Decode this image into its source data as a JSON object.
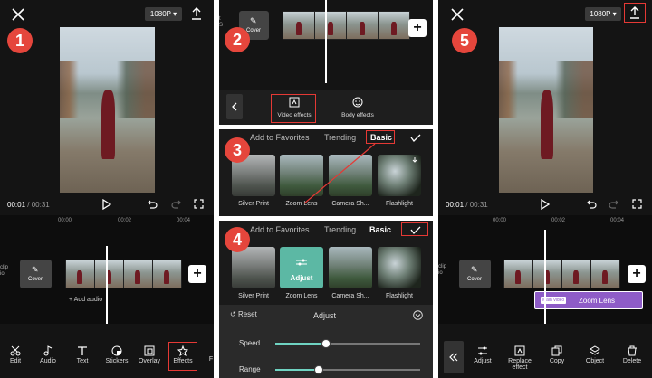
{
  "badges": {
    "b1": "1",
    "b2": "2",
    "b3": "3",
    "b4": "4",
    "b5": "5"
  },
  "panel1": {
    "resolution": "1080P",
    "time_current": "00:01",
    "time_total": "/ 00:31",
    "ruler": [
      "00:00",
      "00:02",
      "00:04"
    ],
    "cover_label": "Cover",
    "clip_side_label": "clip\nio",
    "add_audio": "+ Add audio",
    "tools": [
      "Edit",
      "Audio",
      "Text",
      "Stickers",
      "Overlay",
      "Effects",
      "F"
    ]
  },
  "panel2": {
    "cover_label": "Cover",
    "video_effects": "Video effects",
    "body_effects": "Body effects"
  },
  "panel3": {
    "tabs": [
      "Add to Favorites",
      "Trending",
      "Basic"
    ],
    "effects": [
      "Silver Print",
      "Zoom Lens",
      "Camera Sh...",
      "Flashlight"
    ]
  },
  "panel4": {
    "tabs": [
      "Add to Favorites",
      "Trending",
      "Basic"
    ],
    "effects": [
      "Silver Print",
      "Zoom Lens",
      "Camera Sh...",
      "Flashlight"
    ],
    "adjust_label": "Adjust",
    "reset": "Reset",
    "title": "Adjust",
    "speed_label": "Speed",
    "range_label": "Range",
    "speed_value": 0.35,
    "range_value": 0.3
  },
  "panel5": {
    "resolution": "1080P",
    "time_current": "00:01",
    "time_total": "/ 00:31",
    "ruler": [
      "00:00",
      "00:02",
      "00:04"
    ],
    "cover_label": "Cover",
    "clip_side_label": "clip\nio",
    "main_video_tag": "Main video",
    "effect_clip": "Zoom Lens",
    "tools": [
      "Adjust",
      "Replace effect",
      "Copy",
      "Object",
      "Delete"
    ]
  },
  "colors": {
    "accent_red": "#e53935",
    "teal": "#6fd3c2",
    "effect_purple": "#8e5cc7"
  }
}
